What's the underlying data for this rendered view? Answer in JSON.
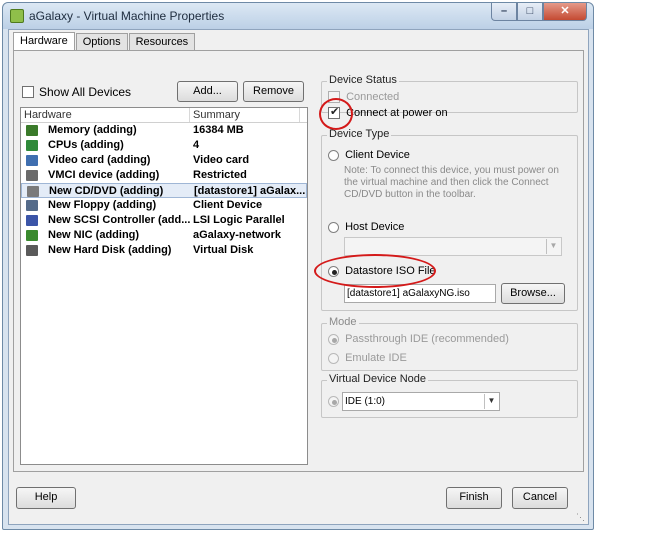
{
  "window": {
    "title": "aGalaxy - Virtual Machine Properties",
    "icon": "vm-properties-icon"
  },
  "tabs": [
    {
      "label": "Hardware",
      "active": true
    },
    {
      "label": "Options",
      "active": false
    },
    {
      "label": "Resources",
      "active": false
    }
  ],
  "hardware": {
    "show_all_devices_label": "Show All Devices",
    "show_all_devices_checked": false,
    "add_button": "Add...",
    "remove_button": "Remove",
    "columns": [
      "Hardware",
      "Summary"
    ],
    "devices": [
      {
        "name": "Memory (adding)",
        "summary": "16384 MB",
        "icon": "memory-icon",
        "color": "#3a7a2a"
      },
      {
        "name": "CPUs (adding)",
        "summary": "4",
        "icon": "cpu-icon",
        "color": "#2f8a3a"
      },
      {
        "name": "Video card  (adding)",
        "summary": "Video card",
        "icon": "monitor-icon",
        "color": "#3f6fb0"
      },
      {
        "name": "VMCI device (adding)",
        "summary": "Restricted",
        "icon": "vmci-icon",
        "color": "#6a6a6a"
      },
      {
        "name": "New CD/DVD (adding)",
        "summary": "[datastore1] aGalax...",
        "icon": "cd-dvd-icon",
        "color": "#7a7a7a",
        "selected": true
      },
      {
        "name": "New Floppy (adding)",
        "summary": "Client Device",
        "icon": "floppy-icon",
        "color": "#556b8a"
      },
      {
        "name": "New SCSI Controller (add...",
        "summary": "LSI Logic Parallel",
        "icon": "scsi-icon",
        "color": "#3b55a8"
      },
      {
        "name": "New NIC (adding)",
        "summary": "aGalaxy-network",
        "icon": "nic-icon",
        "color": "#3a8a2e"
      },
      {
        "name": "New Hard Disk (adding)",
        "summary": "Virtual Disk",
        "icon": "hard-disk-icon",
        "color": "#5a5a5a"
      }
    ]
  },
  "device_status": {
    "title": "Device Status",
    "connected_label": "Connected",
    "connected_checked": false,
    "connect_power_on_label": "Connect at power on",
    "connect_power_on_checked": true
  },
  "device_type": {
    "title": "Device Type",
    "client_device_label": "Client Device",
    "client_device_note": "Note: To connect this device, you must power on the virtual machine and then click the Connect CD/DVD button in the toolbar.",
    "host_device_label": "Host Device",
    "host_device_value": "",
    "datastore_iso_label": "Datastore ISO File",
    "datastore_iso_value": "[datastore1] aGalaxyNG.iso",
    "browse_button": "Browse...",
    "selected": "datastore_iso"
  },
  "mode": {
    "title": "Mode",
    "passthrough_label": "Passthrough IDE (recommended)",
    "emulate_label": "Emulate IDE",
    "selected": "passthrough"
  },
  "virtual_device_node": {
    "title": "Virtual Device Node",
    "value": "IDE (1:0)"
  },
  "footer": {
    "help_button": "Help",
    "finish_button": "Finish",
    "cancel_button": "Cancel"
  },
  "annotation_color": "#d41a1a"
}
